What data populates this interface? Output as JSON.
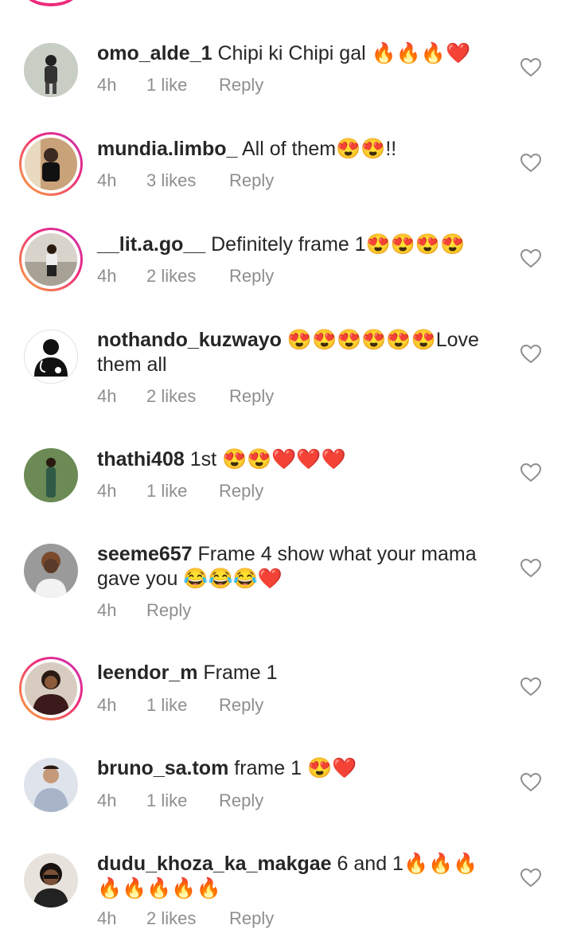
{
  "comments": [
    {
      "username": "omo_alde_1",
      "text": "Chipi ki Chipi gal",
      "emoji": "🔥🔥🔥❤️",
      "time": "4h",
      "likes": "1 like",
      "reply": "Reply",
      "story_ring": false,
      "avatar_color": "#9aa39a"
    },
    {
      "username": "mundia.limbo_",
      "text": "All of them😍😍!!",
      "emoji": "",
      "time": "4h",
      "likes": "3 likes",
      "reply": "Reply",
      "story_ring": true,
      "avatar_color": "#8a6a4a"
    },
    {
      "username": "__lit.a.go__",
      "text": "Definitely frame 1",
      "emoji": "😍😍😍😍",
      "time": "4h",
      "likes": "2 likes",
      "reply": "Reply",
      "story_ring": true,
      "avatar_color": "#b9b3a8"
    },
    {
      "username": "nothando_kuzwayo",
      "text": "😍😍😍😍😍😍Love them all",
      "emoji": "",
      "time": "4h",
      "likes": "2 likes",
      "reply": "Reply",
      "story_ring": false,
      "avatar_color": "#ffffff"
    },
    {
      "username": "thathi408",
      "text": "1st",
      "emoji": "😍😍❤️❤️❤️",
      "time": "4h",
      "likes": "1 like",
      "reply": "Reply",
      "story_ring": false,
      "avatar_color": "#5a7a4a"
    },
    {
      "username": "seeme657",
      "text": "Frame 4 show what your mama gave you 😂😂😂❤️",
      "emoji": "",
      "time": "4h",
      "likes": "",
      "reply": "Reply",
      "story_ring": false,
      "avatar_color": "#6a4a3a"
    },
    {
      "username": "leendor_m",
      "text": "Frame 1",
      "emoji": "",
      "time": "4h",
      "likes": "1 like",
      "reply": "Reply",
      "story_ring": true,
      "avatar_color": "#5a3a3a"
    },
    {
      "username": "bruno_sa.tom",
      "text": "frame 1",
      "emoji": "😍❤️",
      "time": "4h",
      "likes": "1 like",
      "reply": "Reply",
      "story_ring": false,
      "avatar_color": "#8ea0b8"
    },
    {
      "username": "dudu_khoza_ka_makgae",
      "text": "6 and 1🔥🔥🔥🔥🔥🔥🔥🔥",
      "emoji": "",
      "time": "4h",
      "likes": "2 likes",
      "reply": "Reply",
      "story_ring": false,
      "avatar_color": "#3a2a2a"
    }
  ]
}
